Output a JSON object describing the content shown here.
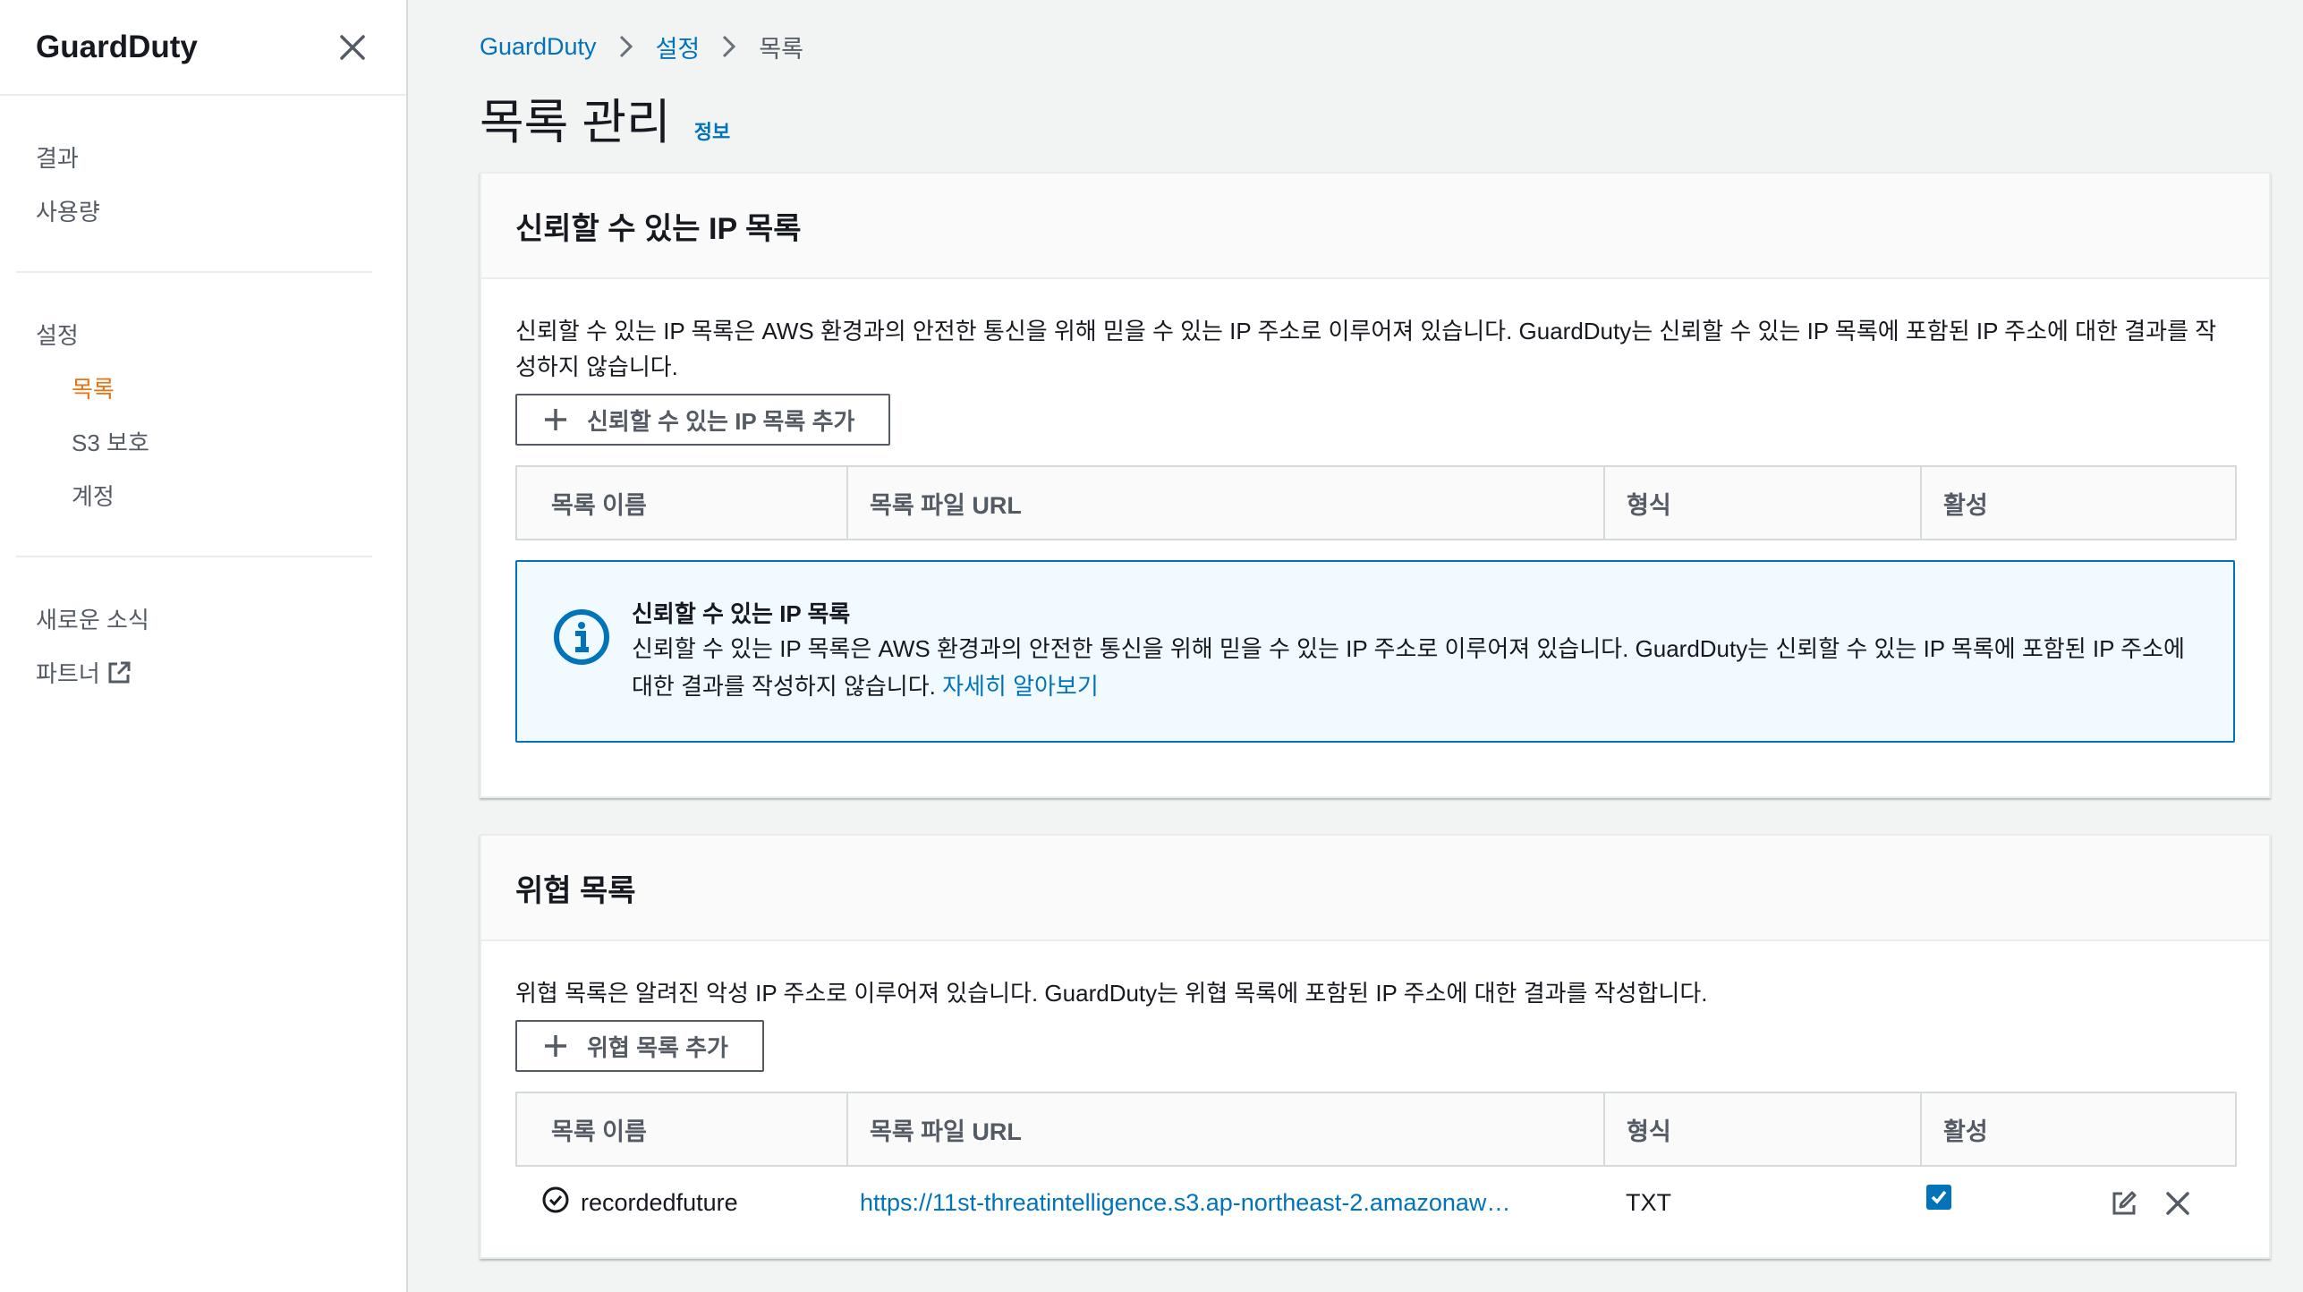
{
  "sidebar": {
    "title": "GuardDuty",
    "items_top": [
      {
        "label": "결과"
      },
      {
        "label": "사용량"
      }
    ],
    "settings_label": "설정",
    "settings_children": [
      {
        "label": "목록",
        "active": true
      },
      {
        "label": "S3 보호"
      },
      {
        "label": "계정"
      }
    ],
    "items_bottom": [
      {
        "label": "새로운 소식"
      },
      {
        "label": "파트너"
      }
    ]
  },
  "breadcrumb": {
    "root": "GuardDuty",
    "middle": "설정",
    "current": "목록"
  },
  "page": {
    "title": "목록 관리",
    "info": "정보"
  },
  "trusted": {
    "title": "신뢰할 수 있는 IP 목록",
    "description": "신뢰할 수 있는 IP 목록은 AWS 환경과의 안전한 통신을 위해 믿을 수 있는 IP 주소로 이루어져 있습니다. GuardDuty는 신뢰할 수 있는 IP 목록에 포함된 IP 주소에 대한 결과를 작성하지 않습니다.",
    "add_button": "신뢰할 수 있는 IP 목록 추가",
    "columns": [
      "목록 이름",
      "목록 파일 URL",
      "형식",
      "활성"
    ],
    "empty_title": "신뢰할 수 있는 IP 목록",
    "empty_text": "신뢰할 수 있는 IP 목록은 AWS 환경과의 안전한 통신을 위해 믿을 수 있는 IP 주소로 이루어져 있습니다. GuardDuty는 신뢰할 수 있는 IP 목록에 포함된 IP 주소에 대한 결과를 작성하지 않습니다.",
    "learn_more": "자세히 알아보기"
  },
  "threat": {
    "title": "위협 목록",
    "description": "위협 목록은 알려진 악성 IP 주소로 이루어져 있습니다. GuardDuty는 위협 목록에 포함된 IP 주소에 대한 결과를 작성합니다.",
    "add_button": "위협 목록 추가",
    "columns": [
      "목록 이름",
      "목록 파일 URL",
      "형식",
      "활성"
    ],
    "rows": [
      {
        "name": "recordedfuture",
        "url": "https://11st-threatintelligence.s3.ap-northeast-2.amazonaw…",
        "format": "TXT",
        "active": true
      }
    ]
  },
  "colors": {
    "accent": "#ec7211",
    "link": "#0073bb",
    "info_bg": "#f1faff"
  }
}
